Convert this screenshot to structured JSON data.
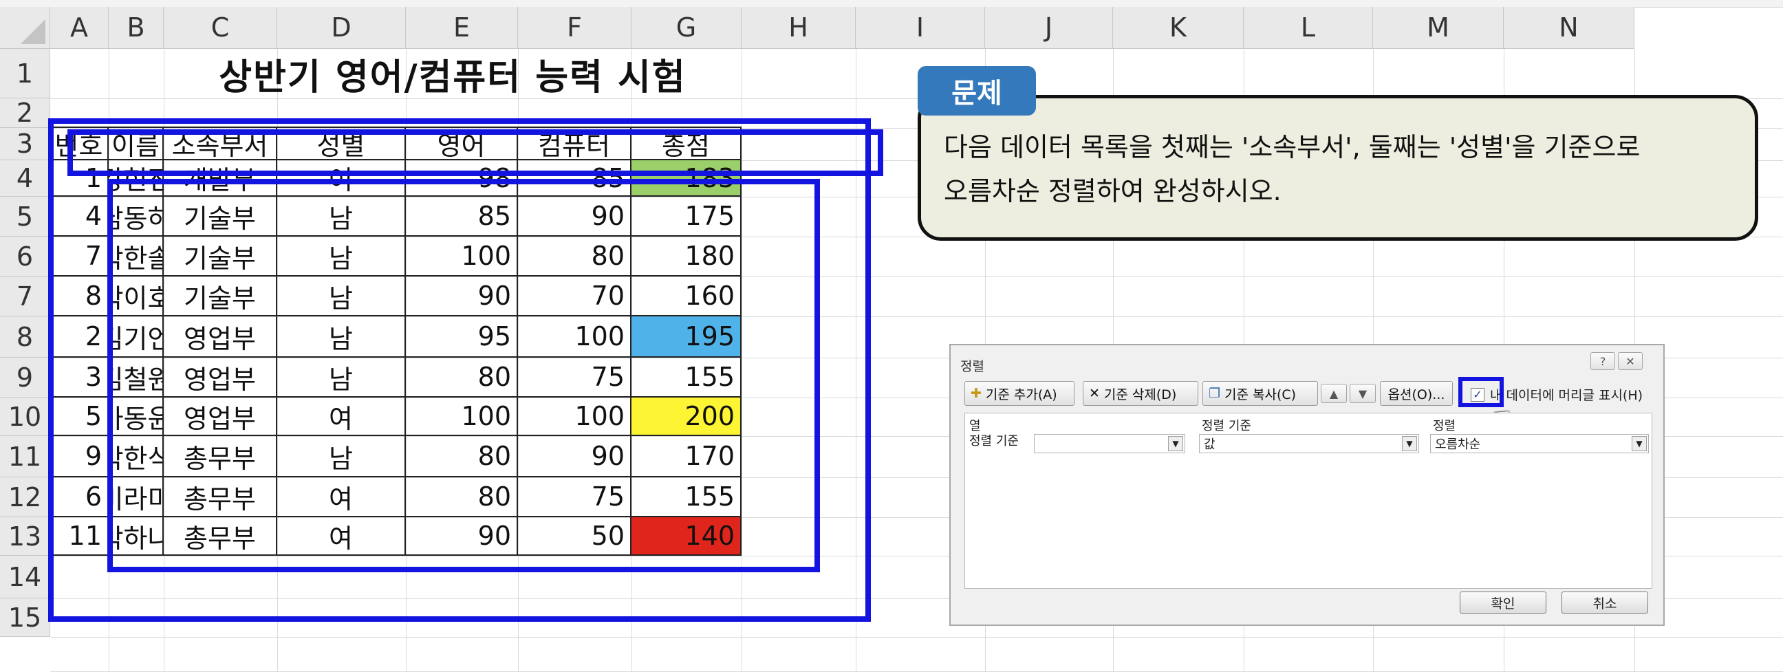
{
  "columns": [
    "A",
    "B",
    "C",
    "D",
    "E",
    "F",
    "G",
    "H",
    "I",
    "J",
    "K",
    "L",
    "M",
    "N"
  ],
  "rows": [
    "1",
    "2",
    "3",
    "4",
    "5",
    "6",
    "7",
    "8",
    "9",
    "10",
    "11",
    "12",
    "13",
    "14",
    "15"
  ],
  "title": "상반기 영어/컴퓨터 능력 시험",
  "table": {
    "headers": [
      "번호",
      "이름",
      "소속부서",
      "성별",
      "영어",
      "컴퓨터",
      "총점"
    ],
    "rows": [
      [
        "1",
        "강현진",
        "개발부",
        "여",
        "98",
        "85",
        "183"
      ],
      [
        "4",
        "남동하",
        "기술부",
        "남",
        "85",
        "90",
        "175"
      ],
      [
        "7",
        "박한솔",
        "기술부",
        "남",
        "100",
        "80",
        "180"
      ],
      [
        "8",
        "박이호",
        "기술부",
        "남",
        "90",
        "70",
        "160"
      ],
      [
        "2",
        "김기언",
        "영업부",
        "남",
        "95",
        "100",
        "195"
      ],
      [
        "3",
        "김철원",
        "영업부",
        "남",
        "80",
        "75",
        "155"
      ],
      [
        "5",
        "마동윤",
        "영업부",
        "여",
        "100",
        "100",
        "200"
      ],
      [
        "9",
        "박한식",
        "총무부",
        "남",
        "80",
        "90",
        "170"
      ],
      [
        "6",
        "미라미",
        "총무부",
        "여",
        "80",
        "75",
        "155"
      ],
      [
        "11",
        "박하나",
        "총무부",
        "여",
        "90",
        "50",
        "140"
      ]
    ],
    "total_fill_colors": [
      "#9bcf6a",
      null,
      null,
      null,
      "#4fb3ea",
      null,
      "#fdf533",
      null,
      null,
      "#e0261c"
    ]
  },
  "callout": {
    "tab": "문제",
    "line1": "다음 데이터 목록을 첫째는 '소속부서', 둘째는 '성별'을 기준으로",
    "line2": "오름차순 정렬하여 완성하시오."
  },
  "dialog": {
    "title": "정렬",
    "help": "?",
    "close": "✕",
    "add_level": "기준 추가(A)",
    "delete_level": "기준 삭제(D)",
    "copy_level": "기준 복사(C)",
    "options": "옵션(O)...",
    "header_checkbox": "내 데이터에 머리글 표시(H)",
    "col_header_column": "열",
    "col_header_sort_on": "정렬 기준",
    "col_header_order": "정렬",
    "row_label": "정렬 기준",
    "row_column_value": "",
    "row_sort_on_value": "값",
    "row_order_value": "오름차순",
    "ok": "확인",
    "cancel": "취소"
  },
  "colors": {
    "annotation_blue": "#1414e0",
    "callout_tab": "#3579bd",
    "callout_bg": "#eeeee0"
  }
}
